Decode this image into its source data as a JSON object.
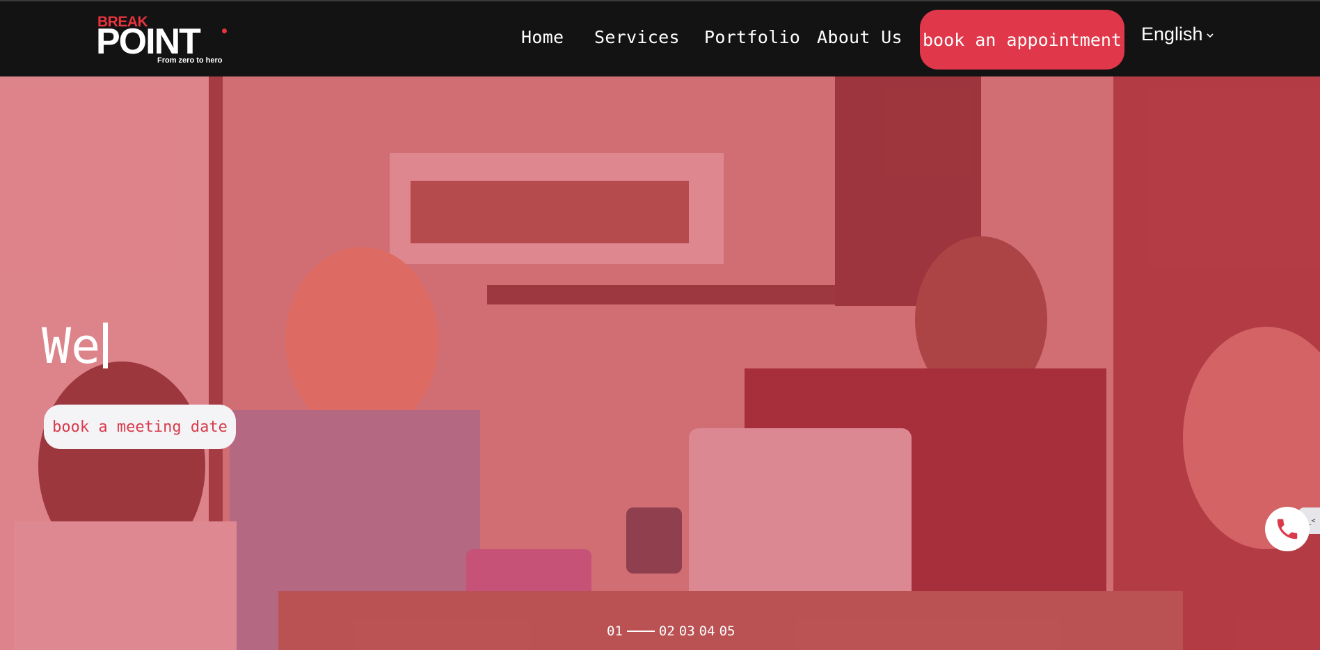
{
  "logo": {
    "line1": "BREAK",
    "line2": "POINT",
    "tagline": "From zero to hero"
  },
  "nav": {
    "links": [
      "Home",
      "Services",
      "Portfolio",
      "About Us"
    ],
    "cta": "book an appointment",
    "language": "English",
    "language_icon": "chevron-down-icon"
  },
  "hero": {
    "heading": "We",
    "button": "book a meeting date",
    "overlay_color": "#d63e4e",
    "pager": {
      "slides": [
        "01",
        "02",
        "03",
        "04",
        "05"
      ],
      "active": "01"
    }
  },
  "floating": {
    "phone_icon": "phone-icon",
    "side_tab": ">_<"
  },
  "colors": {
    "accent": "#e0384a",
    "navbar": "#131313"
  }
}
